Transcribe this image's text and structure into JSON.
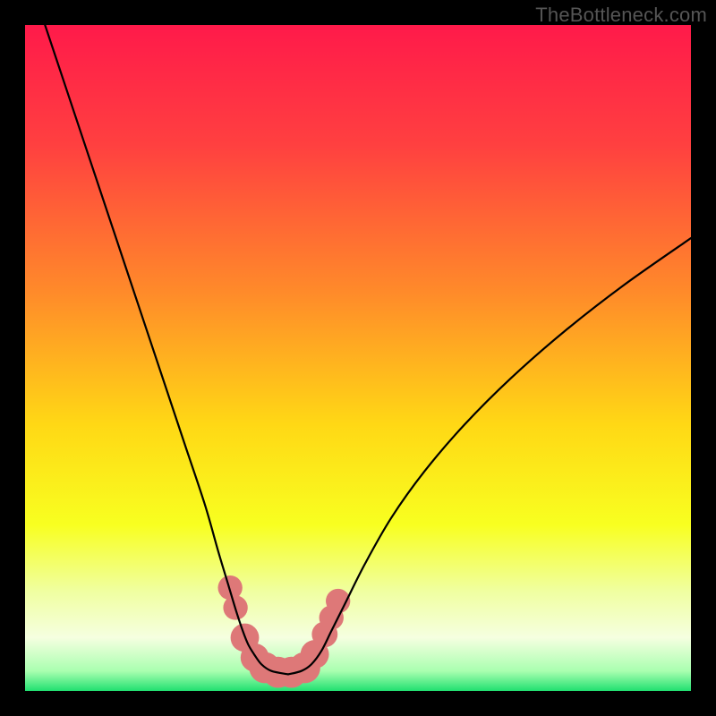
{
  "watermark": "TheBottleneck.com",
  "chart_data": {
    "type": "line",
    "title": "",
    "xlabel": "",
    "ylabel": "",
    "xlim": [
      0,
      100
    ],
    "ylim": [
      0,
      100
    ],
    "grid": false,
    "legend": false,
    "background_gradient_stops": [
      {
        "offset": 0,
        "color": "#ff1a4a"
      },
      {
        "offset": 0.18,
        "color": "#ff4040"
      },
      {
        "offset": 0.4,
        "color": "#ff8a2a"
      },
      {
        "offset": 0.6,
        "color": "#ffd815"
      },
      {
        "offset": 0.75,
        "color": "#f8ff20"
      },
      {
        "offset": 0.85,
        "color": "#f0ffa0"
      },
      {
        "offset": 0.92,
        "color": "#f5ffe0"
      },
      {
        "offset": 0.97,
        "color": "#aaffb0"
      },
      {
        "offset": 1.0,
        "color": "#20e070"
      }
    ],
    "series": [
      {
        "name": "left-curve",
        "stroke": "#000000",
        "x": [
          3,
          6,
          9,
          12,
          15,
          18,
          21,
          24,
          27,
          29,
          30.5,
          31.7,
          32.7,
          33.5,
          34.4,
          35.5,
          37,
          39.5
        ],
        "y": [
          100,
          91,
          82,
          73,
          64,
          55,
          46,
          37,
          28,
          21,
          16,
          12,
          9,
          7,
          5.5,
          4,
          3,
          2.5
        ]
      },
      {
        "name": "right-curve",
        "stroke": "#000000",
        "x": [
          39.5,
          41.5,
          43,
          44.5,
          46,
          48,
          51,
          55,
          60,
          66,
          73,
          81,
          90,
          100
        ],
        "y": [
          2.5,
          3,
          4,
          6,
          9,
          13,
          19,
          26,
          33,
          40,
          47,
          54,
          61,
          68
        ]
      }
    ],
    "markers": {
      "name": "highlight-dots",
      "fill": "#de7878",
      "points": [
        {
          "x": 30.8,
          "y": 15.5,
          "r": 1.3
        },
        {
          "x": 31.6,
          "y": 12.5,
          "r": 1.3
        },
        {
          "x": 33.0,
          "y": 8.0,
          "r": 1.6
        },
        {
          "x": 34.5,
          "y": 5.0,
          "r": 1.6
        },
        {
          "x": 36.0,
          "y": 3.5,
          "r": 1.8
        },
        {
          "x": 38.0,
          "y": 2.8,
          "r": 1.8
        },
        {
          "x": 40.0,
          "y": 2.8,
          "r": 1.8
        },
        {
          "x": 42.0,
          "y": 3.5,
          "r": 1.8
        },
        {
          "x": 43.5,
          "y": 5.5,
          "r": 1.6
        },
        {
          "x": 45.0,
          "y": 8.5,
          "r": 1.4
        },
        {
          "x": 46.0,
          "y": 11.0,
          "r": 1.3
        },
        {
          "x": 47.0,
          "y": 13.5,
          "r": 1.3
        }
      ]
    }
  }
}
